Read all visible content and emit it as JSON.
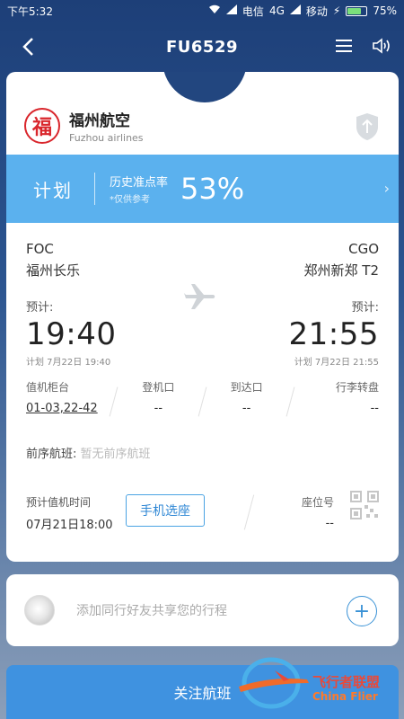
{
  "status_bar": {
    "time": "下午5:32",
    "carrier1": "电信",
    "network": "4G",
    "carrier2": "移动",
    "battery": "75%",
    "battery_level": 0.75
  },
  "header": {
    "title": "FU6529"
  },
  "airline": {
    "name_cn": "福州航空",
    "name_en": "Fuzhou airlines",
    "logo_glyph": "福"
  },
  "status": {
    "label": "计划",
    "ontime_label": "历史准点率",
    "ontime_note": "*仅供参考",
    "ontime_percent": "53%"
  },
  "departure": {
    "code": "FOC",
    "airport": "福州长乐",
    "plan_tag": "预计:",
    "time": "19:40",
    "planned": "计划 7月22日 19:40"
  },
  "arrival": {
    "code": "CGO",
    "airport": "郑州新郑 T2",
    "plan_tag": "预计:",
    "time": "21:55",
    "planned": "计划 7月22日 21:55"
  },
  "info": [
    {
      "label": "值机柜台",
      "value": "01-03,22-42"
    },
    {
      "label": "登机口",
      "value": "--"
    },
    {
      "label": "到达口",
      "value": "--"
    },
    {
      "label": "行李转盘",
      "value": "--"
    }
  ],
  "previous_flight": {
    "label": "前序航班:",
    "value": "暂无前序航班"
  },
  "checkin": {
    "label": "预计值机时间",
    "time": "07月21日18:00"
  },
  "seat_button": "手机选座",
  "seat": {
    "label": "座位号",
    "value": "--"
  },
  "share": {
    "placeholder": "添加同行好友共享您的行程",
    "add_symbol": "+"
  },
  "follow_button": "关注航班",
  "watermark": {
    "cn": "飞行者联盟",
    "en": "China Flier"
  },
  "colors": {
    "accent": "#3f92e0",
    "status_bar": "#5bb1ee",
    "brand_red": "#d9262c"
  }
}
